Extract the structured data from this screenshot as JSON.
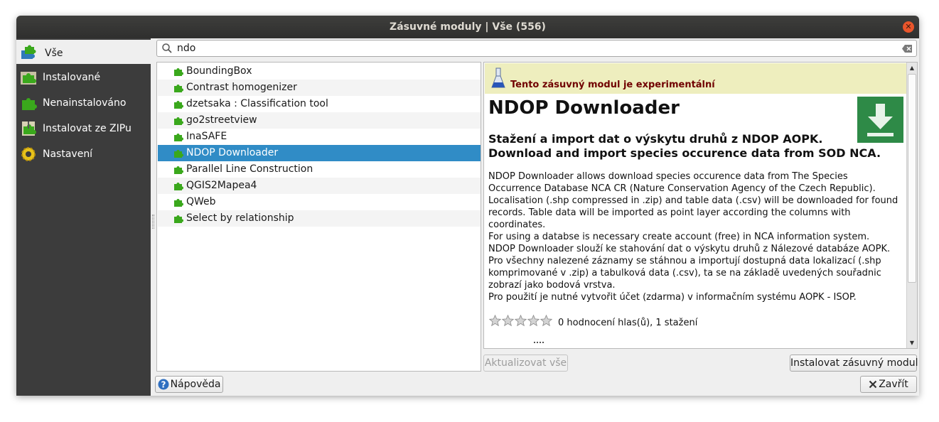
{
  "window": {
    "title": "Zásuvné moduly | Vše (556)",
    "close_glyph": "✕"
  },
  "sidebar": {
    "items": [
      {
        "label": "Vše",
        "icon": "puzzle-all-icon",
        "active": true
      },
      {
        "label": "Instalované",
        "icon": "puzzle-installed-icon"
      },
      {
        "label": "Nenainstalováno",
        "icon": "puzzle-not-installed-icon"
      },
      {
        "label": "Instalovat ze ZIPu",
        "icon": "zip-install-icon"
      },
      {
        "label": "Nastavení",
        "icon": "gear-icon"
      }
    ]
  },
  "search": {
    "value": "ndo",
    "placeholder": ""
  },
  "plugins": [
    "BoundingBox",
    "Contrast homogenizer",
    "dzetsaka : Classification tool",
    "go2streetview",
    "InaSAFE",
    "NDOP Downloader",
    "Parallel Line Construction",
    "QGIS2Mapea4",
    "QWeb",
    "Select by relationship"
  ],
  "selected_index": 5,
  "detail": {
    "experimental": "Tento zásuvný modul je experimentální",
    "title": "NDOP Downloader",
    "subtitle_cz": "Stažení a import dat o výskytu druhů z NDOP AOPK.",
    "subtitle_en": "Download and import species occurence data from SOD NCA.",
    "description": [
      "NDOP Downloader allows download species occurence data from The Species",
      "Occurrence Database NCA CR (Nature Conservation Agency of the Czech Republic).",
      "Localisation (.shp compressed in .zip) and table data (.csv) will be downloaded for found",
      "records. Table data will be imported as point layer according the columns with",
      "coordinates.",
      "For using a databse is necessary create account (free) in NCA information system.",
      "NDOP Downloader slouží ke stahování dat o výskytu druhů z Nálezové databáze AOPK.",
      "Pro všechny nalezené záznamy se stáhnou a importují dostupná data lokalizací (.shp",
      "komprimované v .zip) a tabulková data (.csv), ta se na základě uvedených souřadnic",
      "zobrazí jako bodová vrstva.",
      "Pro použití je nutné vytvořit účet (zdarma) v informačním systému AOPK - ISOP."
    ],
    "rating_stars": 0,
    "rating_max": 5,
    "rating_text": "0 hodnocení hlas(ů), 1 stažení"
  },
  "buttons": {
    "update_all": "Aktualizovat vše",
    "install": "Instalovat zásuvný modul",
    "help": "Nápověda",
    "close": "Zavřít"
  },
  "colors": {
    "selection": "#308cc6",
    "sidebar": "#3c3c3c",
    "puzzle_green": "#3aa81c",
    "experimental_bg": "#eeeebe",
    "experimental_text": "#700000",
    "logo_green": "#2e8a47"
  }
}
